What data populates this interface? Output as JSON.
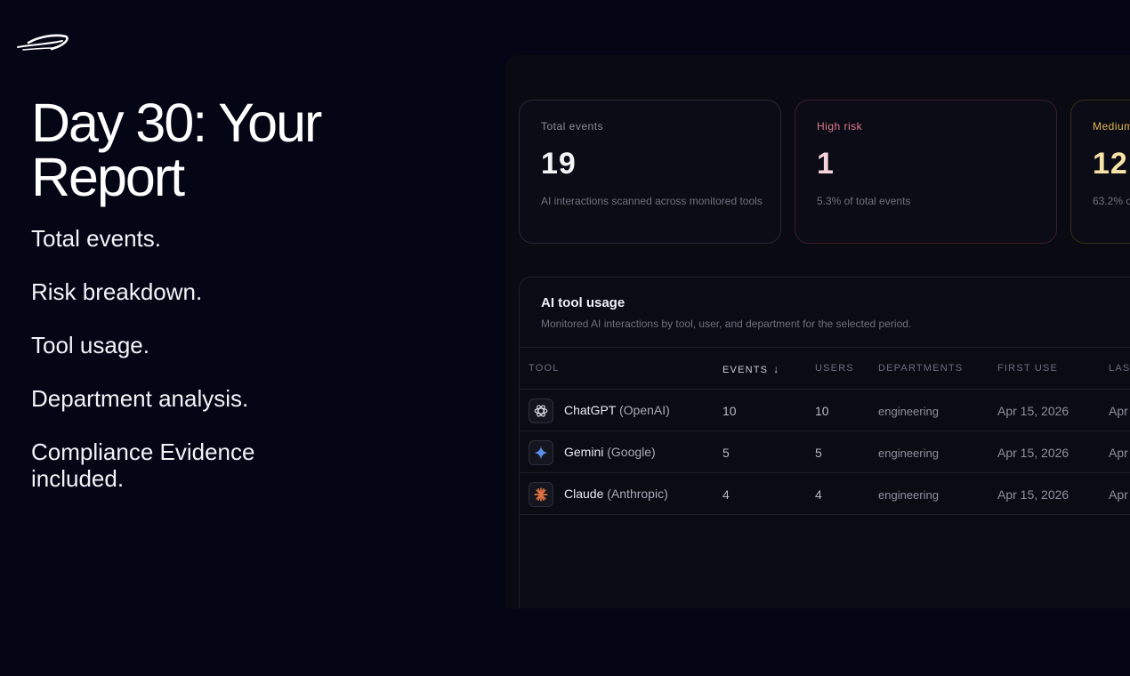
{
  "headline": "Day 30: Your Report",
  "features": [
    "Total events.",
    "Risk breakdown.",
    "Tool usage.",
    "Department analysis.",
    "Compliance Evidence included."
  ],
  "stats": {
    "total": {
      "label": "Total events",
      "value": "19",
      "desc": "AI interactions scanned across monitored tools"
    },
    "high": {
      "label": "High risk",
      "value": "1",
      "desc": "5.3% of total events"
    },
    "medium": {
      "label": "Medium",
      "value": "12",
      "desc": "63.2% o"
    }
  },
  "table": {
    "title": "AI tool usage",
    "subtitle": "Monitored AI interactions by tool, user, and department for the selected period.",
    "columns": {
      "tool": "TOOL",
      "events": "EVENTS",
      "users": "USERS",
      "departments": "DEPARTMENTS",
      "first_use": "FIRST USE",
      "last": "LAS"
    },
    "rows": [
      {
        "tool": "ChatGPT",
        "vendor": "(OpenAI)",
        "icon": "openai-icon",
        "events": "10",
        "users": "10",
        "department": "engineering",
        "first_use": "Apr 15, 2026",
        "last": "Apr"
      },
      {
        "tool": "Gemini",
        "vendor": "(Google)",
        "icon": "gemini-icon",
        "events": "5",
        "users": "5",
        "department": "engineering",
        "first_use": "Apr 15, 2026",
        "last": "Apr"
      },
      {
        "tool": "Claude",
        "vendor": "(Anthropic)",
        "icon": "claude-icon",
        "events": "4",
        "users": "4",
        "department": "engineering",
        "first_use": "Apr 15, 2026",
        "last": "Apr"
      }
    ]
  },
  "colors": {
    "background": "#040616",
    "high_risk": "#e07a8e",
    "medium_risk": "#e0b552",
    "gemini": "#5b8fe8",
    "claude": "#e0733f"
  }
}
